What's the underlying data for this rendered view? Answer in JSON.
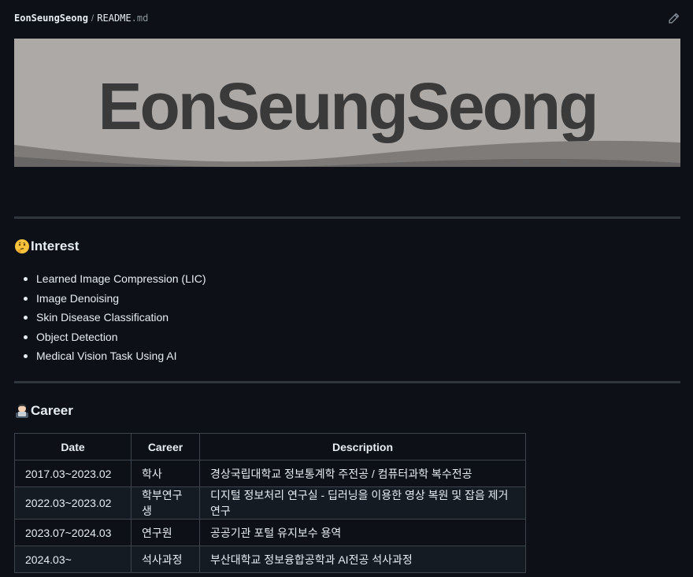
{
  "header": {
    "owner": "EonSeungSeong",
    "separator": "/",
    "file_name": "README",
    "file_ext": ".md",
    "edit_icon": "pencil-icon"
  },
  "banner": {
    "text": "EonSeungSeong",
    "bg_color": "#aca9a6",
    "text_color": "#3a3a3b"
  },
  "interest": {
    "title": "Interest",
    "icon": "thinking-face-icon",
    "items": [
      "Learned Image Compression (LIC)",
      "Image Denoising",
      "Skin Disease Classification",
      "Object Detection",
      "Medical Vision Task Using AI"
    ]
  },
  "career": {
    "title": "Career",
    "icon": "technologist-icon",
    "columns": [
      "Date",
      "Career",
      "Description"
    ],
    "rows": [
      {
        "date": "2017.03~2023.02",
        "career": "학사",
        "description": "경상국립대학교 정보통계학 주전공 / 컴퓨터과학 복수전공"
      },
      {
        "date": "2022.03~2023.02",
        "career": "학부연구생",
        "description": "디지털 정보처리 연구실 - 딥러닝을 이용한 영상 복원 및 잡음 제거 연구"
      },
      {
        "date": "2023.07~2024.03",
        "career": "연구원",
        "description": "공공기관 포털 유지보수 용역"
      },
      {
        "date": "2024.03~",
        "career": "석사과정",
        "description": "부산대학교 정보융합공학과 AI전공 석사과정"
      }
    ]
  },
  "colors": {
    "background": "#0d1117",
    "text": "#e6edf3",
    "border": "#3d444d",
    "divider": "#30363d"
  }
}
